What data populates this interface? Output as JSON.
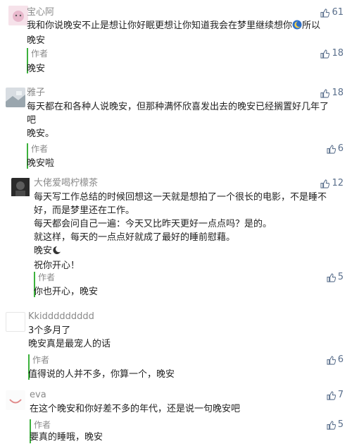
{
  "comments": [
    {
      "nick": "宝心阿",
      "likes": "61",
      "lines": [
        "我和你说晚安不止是想让你好眠更想让你知道我会在梦里继续想你",
        "所以",
        "晚安"
      ],
      "reply_tag": "作者",
      "reply_likes": "18",
      "reply_text": "晚安"
    },
    {
      "nick": "雅子",
      "likes": "18",
      "lines": [
        "每天都在和各种人说晚安，但那种满怀欣喜发出去的晚安已经搁置好几年了",
        "吧",
        "晚安。"
      ],
      "reply_tag": "作者",
      "reply_likes": "6",
      "reply_text": "晚安啦"
    },
    {
      "nick": "大佬爱喝柠檬茶",
      "likes": "12",
      "lines": [
        "每天写工作总结的时候回想这一天就是想拍了一个很长的电影，不是睡不",
        "好，而是梦里还在工作。",
        "每天都会问自己一遍：今天又比昨天更好一点点吗？是的。",
        "就这样，每天的一点点好就成了最好的睡前慰藉。",
        "晚安",
        "祝你开心！"
      ],
      "reply_tag": "作者",
      "reply_likes": "5",
      "reply_text": "你也开心，晚安"
    },
    {
      "nick": "Kkiddddddddd",
      "likes": "",
      "lines": [
        "3个多月了",
        "晚安真是最宠人的话"
      ],
      "reply_tag": "作者",
      "reply_likes": "6",
      "reply_text": "值得说的人并不多，你算一个，晚安"
    },
    {
      "nick": "eva",
      "likes": "7",
      "lines": [
        "在这个晚安和你好差不多的年代，还是说一句晚安吧"
      ],
      "reply_tag": "作者",
      "reply_likes": "5",
      "reply_text": "要真的睡哦，晚安"
    }
  ],
  "colors": {
    "accent_green": "#3cb13c",
    "like_blue": "#5a6f8c",
    "meta_gray": "#8a8a8a"
  }
}
